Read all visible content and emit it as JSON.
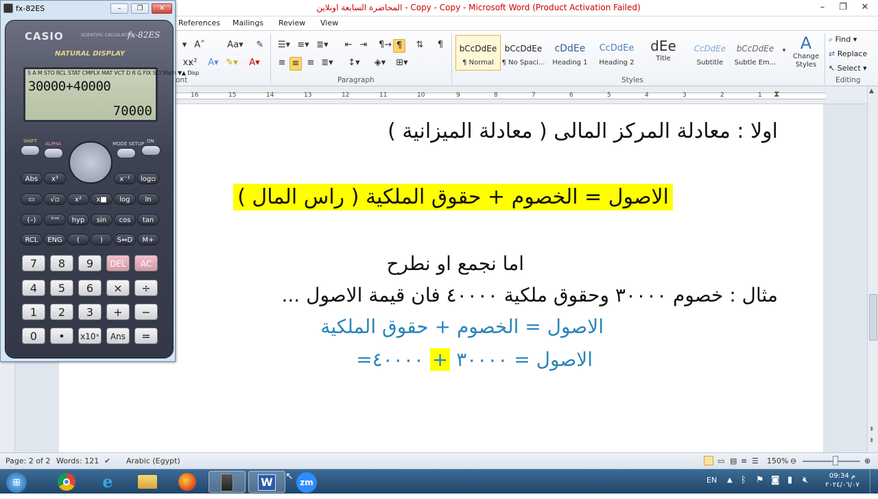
{
  "window": {
    "title": "المحاضرة السابعة اونلاين - Copy - Copy - Microsoft Word (Product Activation Failed)",
    "controls": [
      "–",
      "❐",
      "✕"
    ]
  },
  "tabs": [
    "References",
    "Mailings",
    "Review",
    "View"
  ],
  "ribbon": {
    "groups": {
      "font": "ont",
      "paragraph": "Paragraph",
      "styles": "Styles",
      "editing": "Editing"
    },
    "styles": [
      {
        "preview": "bCcDdEe",
        "name": "¶ Normal"
      },
      {
        "preview": "bCcDdEe",
        "name": "¶ No Spaci..."
      },
      {
        "preview": "cDdEe",
        "name": "Heading 1"
      },
      {
        "preview": "CcDdEe",
        "name": "Heading 2"
      },
      {
        "preview": "dEe",
        "name": "Title"
      },
      {
        "preview": "CcDdEe",
        "name": "Subtitle"
      },
      {
        "preview": "bCcDdEe",
        "name": "Subtle Em..."
      }
    ],
    "change_styles": "Change Styles",
    "editing": {
      "find": "Find",
      "replace": "Replace",
      "select": "Select"
    }
  },
  "ruler": {
    "numbers": [
      "16",
      "15",
      "14",
      "13",
      "12",
      "11",
      "10",
      "9",
      "8",
      "7",
      "6",
      "5",
      "4",
      "3",
      "2",
      "1"
    ]
  },
  "document": {
    "line1": "اولا : معادلة المركز المالى ( معادلة الميزانية )",
    "line2": "الاصول = الخصوم + حقوق الملكية ( راس المال )",
    "line3": "اما نجمع او نطرح",
    "line4": "مثال : خصوم ٣٠٠٠٠ وحقوق ملكية ٤٠٠٠٠ فان قيمة الاصول ...",
    "line5": "الاصول = الخصوم + حقوق الملكية",
    "line6_a": "الاصول = ٣٠٠٠٠ ",
    "line6_plus": "+",
    "line6_b": " ٤٠٠٠٠=",
    "colors": {
      "highlight": "#ffff00",
      "blue_text": "#2a85b8"
    }
  },
  "status": {
    "page": "Page: 2 of 2",
    "words": "Words: 121",
    "language": "Arabic (Egypt)",
    "zoom": "150%"
  },
  "calculator": {
    "window_title": "fx-82ES",
    "brand": "CASIO",
    "model_label": "SCIENTIFIC CALCULATOR",
    "model": "fx-82ES",
    "display_type": "NATURAL DISPLAY",
    "indicators": "S A M STO RCL STAT CMPLX MAT VCT D R G FIX SCI Math ▼▲ Disp",
    "input": "30000+40000",
    "result": "70000",
    "top_labels": {
      "shift": "SHIFT",
      "alpha": "ALPHA",
      "mode": "MODE SETUP",
      "on": "ON"
    },
    "fn_rows": [
      [
        "Abs",
        "x³",
        "x⁻¹",
        "log▫"
      ],
      [
        "▭",
        "√▫",
        "x²",
        "x■",
        "log",
        "ln"
      ],
      [
        "(–)",
        "°'\"",
        "hyp",
        "sin",
        "cos",
        "tan"
      ],
      [
        "RCL",
        "ENG",
        "(",
        ")",
        "S⇔D",
        "M+"
      ]
    ],
    "num_rows": [
      [
        "7",
        "8",
        "9",
        "DEL",
        "AC"
      ],
      [
        "4",
        "5",
        "6",
        "×",
        "÷"
      ],
      [
        "1",
        "2",
        "3",
        "+",
        "−"
      ],
      [
        "0",
        "•",
        "x10ˣ",
        "Ans",
        "="
      ]
    ]
  },
  "taskbar": {
    "clock_time": "09:34 م",
    "clock_date": "٢٠٢٤/٠٦/٠٧",
    "lang": "EN",
    "apps": [
      "start-icon",
      "chrome-icon",
      "ie-icon",
      "explorer-icon",
      "firefox-icon",
      "calculator-icon",
      "word-icon",
      "zoom-icon"
    ],
    "zoom_label": "zm"
  }
}
